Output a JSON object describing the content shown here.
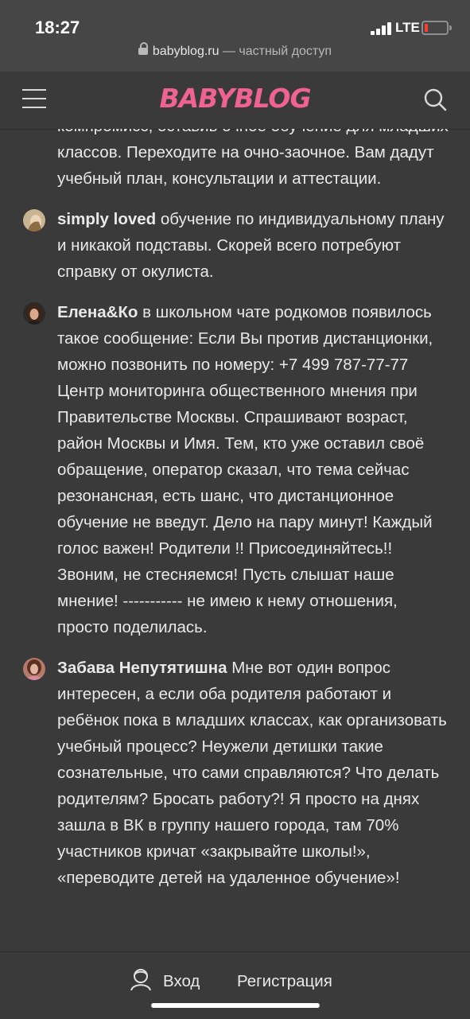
{
  "status_bar": {
    "time": "18:27",
    "network": "LTE",
    "battery_level": 0.15
  },
  "url_bar": {
    "host": "babyblog.ru",
    "suffix": " — частный доступ"
  },
  "header": {
    "logo": "BABYBLOG"
  },
  "comments": [
    {
      "author": "",
      "text": "компромисс, оставив очное обучение для младших классов. Переходите на очно-заочное. Вам дадут учебный план, консультации и аттестации."
    },
    {
      "author": "simply loved",
      "text": "обучение по индивидуальному плану и никакой подставы. Скорей всего потребуют справку от окулиста."
    },
    {
      "author": "Елена&Ко",
      "text": "в школьном чате родкомов появилось такое сообщение: Если Вы против дистанционки, можно позвонить по номеру: +7 499 787-77-77 Центр мониторинга общественного мнения при Правительстве Москвы. Спрашивают возраст, район Москвы и Имя. Тем, кто уже оставил своё обращение, оператор сказал, что тема сейчас резонансная, есть шанс, что дистанционное обучение не введут. Дело на пару минут! Каждый голос важен! Родители !! Присоединяйтесь!! Звоним, не стесняемся! Пусть слышат наше мнение! ----------- не имею к нему отношения, просто поделилась."
    },
    {
      "author": "Забава Непутятишна",
      "text": "Мне вот один вопрос интересен, а если оба родителя работают и ребёнок пока в младших классах, как организовать учебный процесс? Неужели детишки такие сознательные, что сами справляются? Что делать родителям? Бросать работу?! Я просто на днях зашла в ВК в группу нашего города, там 70% участников кричат «закрывайте школы!», «переводите детей на удаленное обучение»!"
    }
  ],
  "bottom_bar": {
    "login_label": "Вход",
    "register_label": "Регистрация"
  },
  "colors": {
    "background": "#3a3a3a",
    "logo": "#f06292",
    "text": "#e9e9e9"
  },
  "icons": [
    "menu-icon",
    "search-icon",
    "login-icon",
    "lock-icon",
    "signal-icon",
    "battery-icon"
  ]
}
